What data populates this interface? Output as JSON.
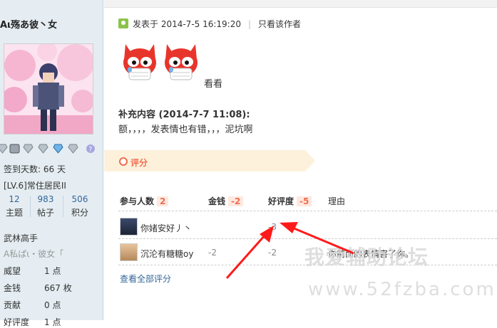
{
  "sidebar": {
    "username": "Aι殇あ彼丶女",
    "signin_days": "签到天数: 66 天",
    "level": "[LV.6]常住居民II",
    "stats": [
      {
        "num": "12",
        "label": "主题"
      },
      {
        "num": "983",
        "label": "帖子"
      },
      {
        "num": "506",
        "label": "积分"
      }
    ],
    "title": "武林高手",
    "custom_title": "A私ぱι・彼女「",
    "fields": [
      {
        "label": "威望",
        "value": "1 点"
      },
      {
        "label": "金钱",
        "value": "667 枚"
      },
      {
        "label": "贡献",
        "value": "0 点"
      },
      {
        "label": "好评度",
        "value": "1 点"
      }
    ]
  },
  "post": {
    "posted_at": "发表于 2014-7-5 16:19:20",
    "only_author": "只看该作者",
    "after_faces": "看看",
    "supplement_title": "补充内容 (2014-7-7 11:08):",
    "supplement_body": "额，，，，发表情也有错，，，泥坑啊"
  },
  "rating": {
    "tab_label": "评分",
    "headers": {
      "participants": "参与人数",
      "participants_count": "2",
      "money": "金钱",
      "money_total": "-2",
      "reputation": "好评度",
      "reputation_total": "-5",
      "reason": "理由"
    },
    "rows": [
      {
        "name": "你媎安好丿丶",
        "money": "",
        "reputation": "-3",
        "reason": ""
      },
      {
        "name": "沉沦有糖糖oy",
        "money": "-2",
        "reputation": "-2",
        "reason": "你前面的表情害了你。"
      }
    ],
    "view_all": "查看全部评分"
  },
  "watermark": {
    "line1": "我爱辅助论坛",
    "line2": "www.52fzba.com"
  },
  "colors": {
    "accent": "#f26c4f",
    "link": "#336699",
    "sidebar_bg": "#e5edf2",
    "arrow": "#ff1a1a"
  },
  "icons": [
    "online-icon",
    "medal-icon",
    "fox-emoticon",
    "rate-circle-icon",
    "arrow-annotation"
  ]
}
